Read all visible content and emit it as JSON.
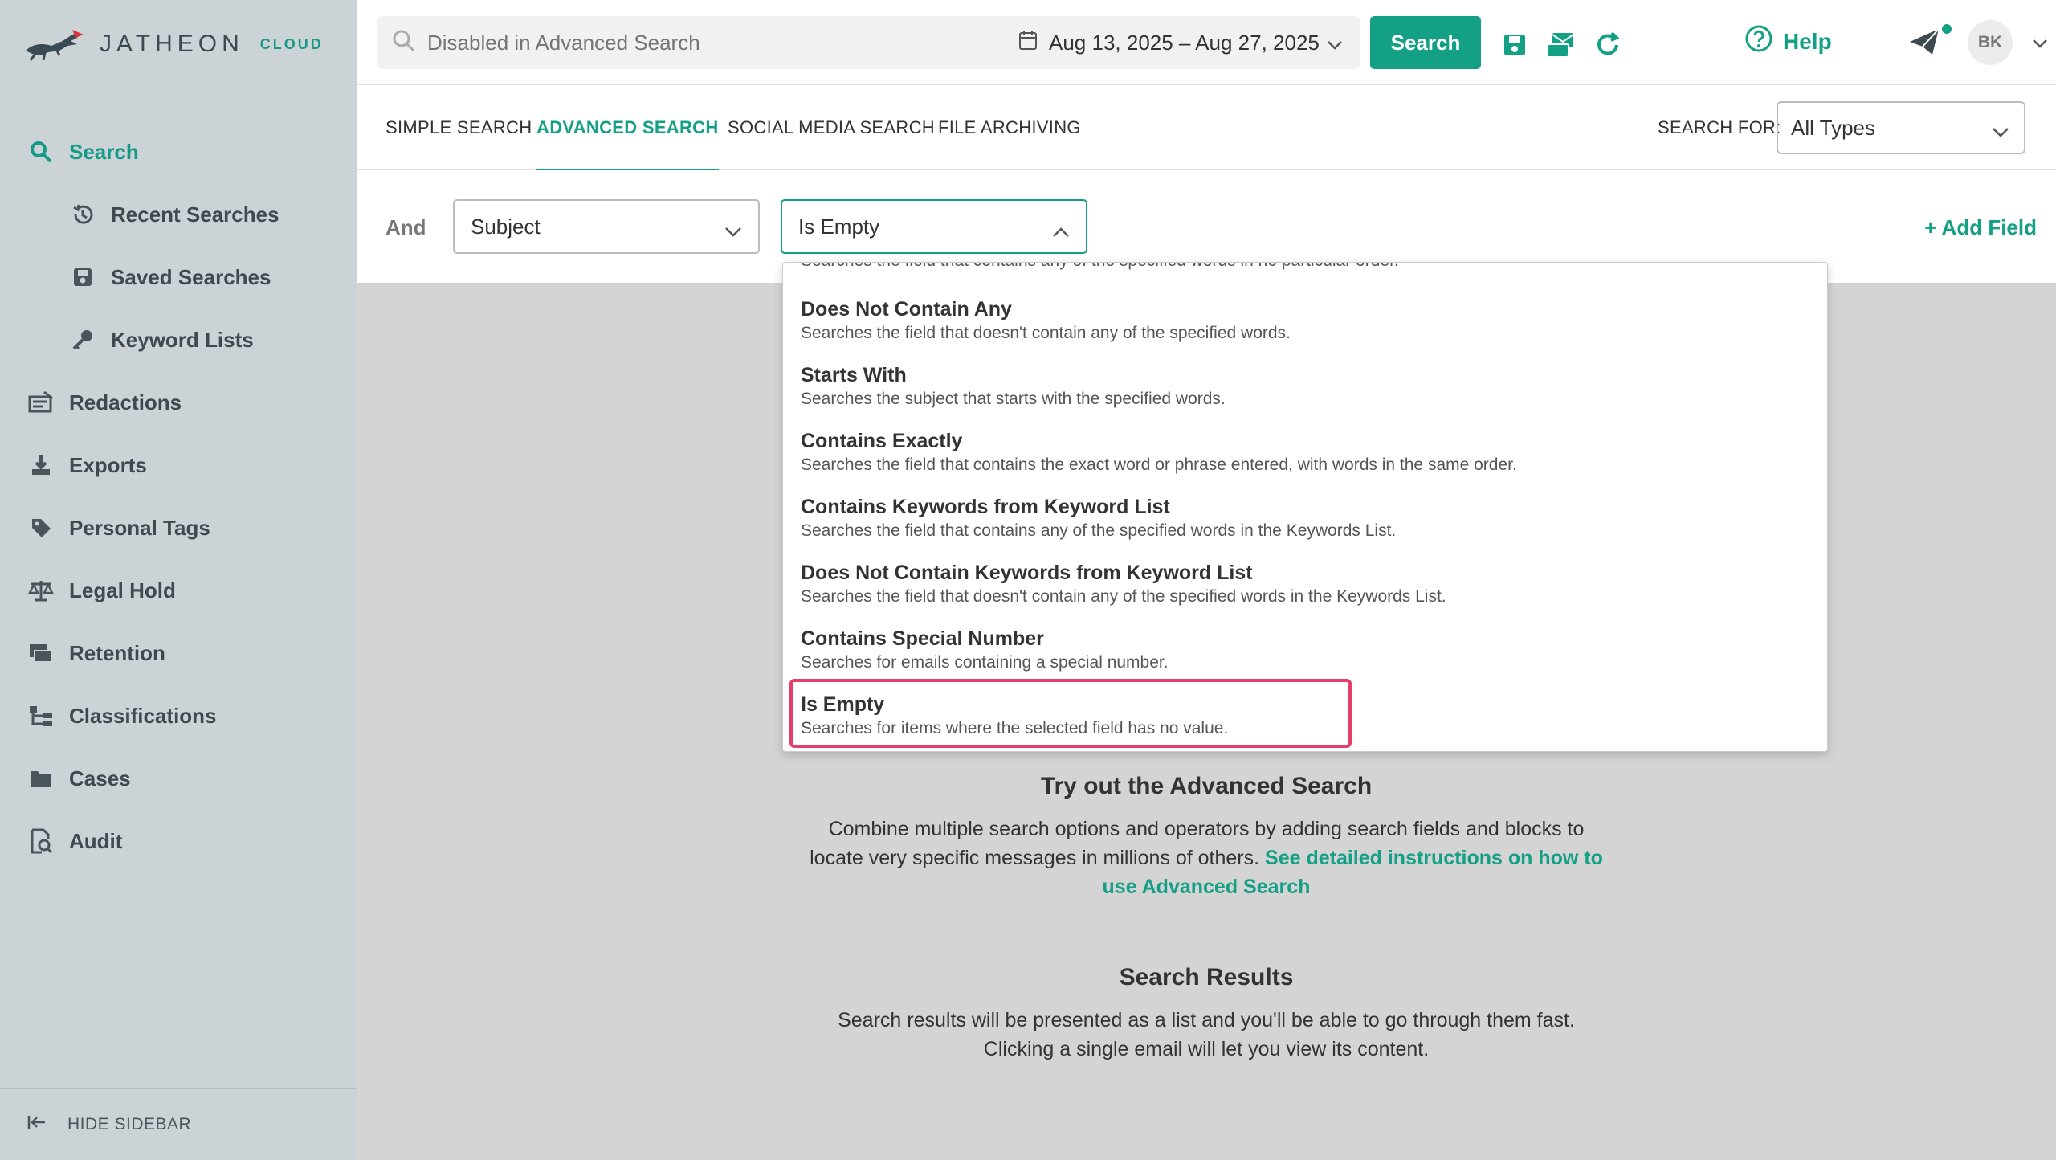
{
  "brand": {
    "name": "JATHEON",
    "sub": "CLOUD"
  },
  "sidebar": {
    "items": [
      {
        "label": "Search",
        "icon": "search-icon"
      },
      {
        "label": "Recent Searches",
        "icon": "history-icon"
      },
      {
        "label": "Saved Searches",
        "icon": "save-icon"
      },
      {
        "label": "Keyword Lists",
        "icon": "key-icon"
      },
      {
        "label": "Redactions",
        "icon": "redaction-icon"
      },
      {
        "label": "Exports",
        "icon": "download-icon"
      },
      {
        "label": "Personal Tags",
        "icon": "tag-icon"
      },
      {
        "label": "Legal Hold",
        "icon": "scale-icon"
      },
      {
        "label": "Retention",
        "icon": "retention-icon"
      },
      {
        "label": "Classifications",
        "icon": "hierarchy-icon"
      },
      {
        "label": "Cases",
        "icon": "folder-icon"
      },
      {
        "label": "Audit",
        "icon": "audit-icon"
      }
    ],
    "footer": "HIDE SIDEBAR"
  },
  "topbar": {
    "search_placeholder": "Disabled in Advanced Search",
    "date_range": "Aug 13, 2025 – Aug 27, 2025",
    "search_button": "Search",
    "help": "Help",
    "avatar": "BK"
  },
  "tabs": [
    "SIMPLE SEARCH",
    "ADVANCED SEARCH",
    "SOCIAL MEDIA SEARCH",
    "FILE ARCHIVING"
  ],
  "search_for": {
    "label": "SEARCH FOR:",
    "value": "All Types"
  },
  "field_row": {
    "conjunction": "And",
    "field": "Subject",
    "operator": "Is Empty",
    "add_field": "+ Add Field"
  },
  "dropdown": {
    "partial_text": "Searches the field that contains any of the specified words in no particular order.",
    "options": [
      {
        "title": "Does Not Contain Any",
        "desc": "Searches the field that doesn't contain any of the specified words."
      },
      {
        "title": "Starts With",
        "desc": "Searches the subject that starts with the specified words."
      },
      {
        "title": "Contains Exactly",
        "desc": "Searches the field that contains the exact word or phrase entered, with words in the same order."
      },
      {
        "title": "Contains Keywords from Keyword List",
        "desc": "Searches the field that contains any of the specified words in the Keywords List."
      },
      {
        "title": "Does Not Contain Keywords from Keyword List",
        "desc": "Searches the field that doesn't contain any of the specified words in the Keywords List."
      },
      {
        "title": "Contains Special Number",
        "desc": "Searches for emails containing a special number."
      },
      {
        "title": "Is Empty",
        "desc": "Searches for items where the selected field has no value."
      }
    ]
  },
  "main": {
    "try_title": "Try out the Advanced Search",
    "try_text": "Combine multiple search options and operators by adding search fields and blocks to locate very specific messages in millions of others.",
    "try_link": "See detailed instructions on how to use Advanced Search",
    "results_title": "Search Results",
    "results_text": "Search results will be presented as a list and you'll be able to go through them fast. Clicking a single email will let you view its content."
  },
  "colors": {
    "accent": "#13a085",
    "sidebar_bg": "#ccd3d7",
    "highlight": "#e63d6b"
  }
}
